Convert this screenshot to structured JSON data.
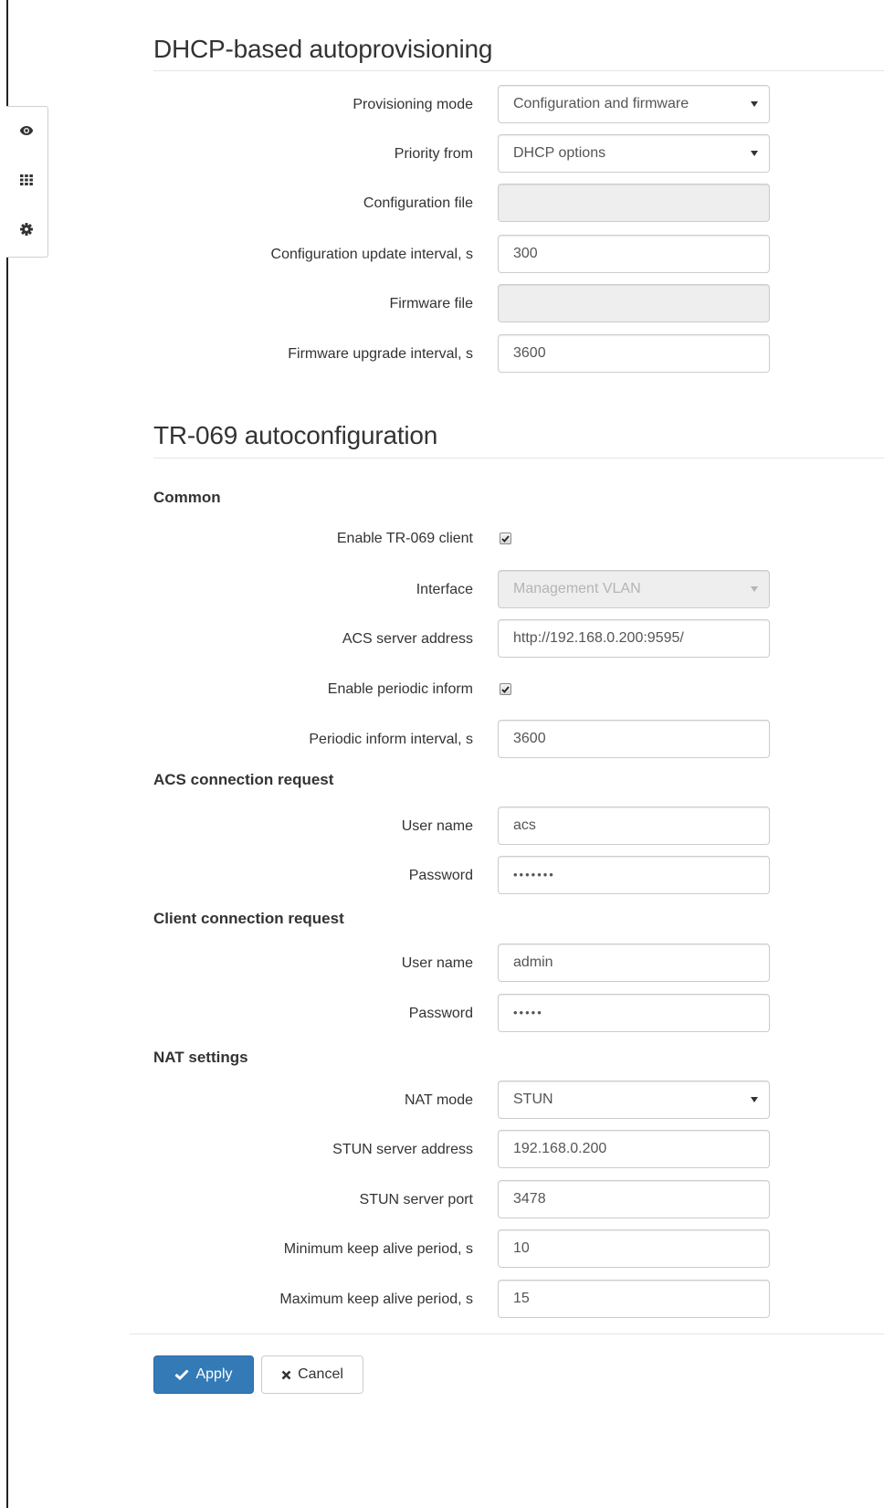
{
  "sidebar": {
    "icons": [
      "eye-icon",
      "grid-icon",
      "gear-icon"
    ]
  },
  "dhcp": {
    "title": "DHCP-based autoprovisioning",
    "provisioning_mode_label": "Provisioning mode",
    "provisioning_mode_value": "Configuration and firmware",
    "priority_from_label": "Priority from",
    "priority_from_value": "DHCP options",
    "config_file_label": "Configuration file",
    "config_file_value": "",
    "config_update_interval_label": "Configuration update interval, s",
    "config_update_interval_value": "300",
    "firmware_file_label": "Firmware file",
    "firmware_file_value": "",
    "firmware_upgrade_interval_label": "Firmware upgrade interval, s",
    "firmware_upgrade_interval_value": "3600"
  },
  "tr069": {
    "title": "TR-069 autoconfiguration",
    "common": {
      "title": "Common",
      "enable_client_label": "Enable TR-069 client",
      "enable_client_checked": true,
      "interface_label": "Interface",
      "interface_value": "Management VLAN",
      "acs_address_label": "ACS server address",
      "acs_address_value": "http://192.168.0.200:9595/",
      "enable_periodic_label": "Enable periodic inform",
      "enable_periodic_checked": true,
      "periodic_interval_label": "Periodic inform interval, s",
      "periodic_interval_value": "3600"
    },
    "acs_request": {
      "title": "ACS connection request",
      "user_label": "User name",
      "user_value": "acs",
      "password_label": "Password",
      "password_value": "•••••••"
    },
    "client_request": {
      "title": "Client connection request",
      "user_label": "User name",
      "user_value": "admin",
      "password_label": "Password",
      "password_value": "•••••"
    },
    "nat": {
      "title": "NAT settings",
      "mode_label": "NAT mode",
      "mode_value": "STUN",
      "stun_address_label": "STUN server address",
      "stun_address_value": "192.168.0.200",
      "stun_port_label": "STUN server port",
      "stun_port_value": "3478",
      "min_keepalive_label": "Minimum keep alive period, s",
      "min_keepalive_value": "10",
      "max_keepalive_label": "Maximum keep alive period, s",
      "max_keepalive_value": "15"
    }
  },
  "actions": {
    "apply_label": "Apply",
    "cancel_label": "Cancel",
    "apply_color": "#337ab7"
  }
}
